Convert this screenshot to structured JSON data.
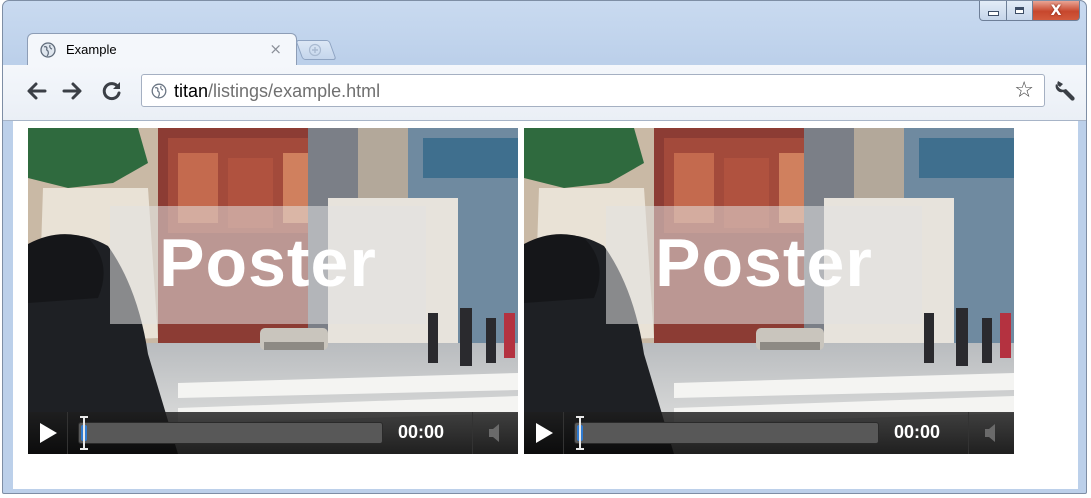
{
  "window": {
    "controls": {
      "minimize": "minimize",
      "maximize": "maximize",
      "close": "X"
    }
  },
  "tab": {
    "title": "Example",
    "close_glyph": "×",
    "icon": "globe-icon"
  },
  "new_tab": {
    "icon": "new-tab-icon"
  },
  "toolbar": {
    "back_icon": "back-arrow-icon",
    "forward_icon": "forward-arrow-icon",
    "reload_icon": "reload-icon",
    "wrench_icon": "wrench-icon"
  },
  "omnibox": {
    "host": "titan",
    "path": "/listings/example.html",
    "star_glyph": "☆"
  },
  "videos": [
    {
      "poster_text": "Poster",
      "time": "00:00",
      "progress": 0.02
    },
    {
      "poster_text": "Poster",
      "time": "00:00",
      "progress": 0.02
    }
  ]
}
